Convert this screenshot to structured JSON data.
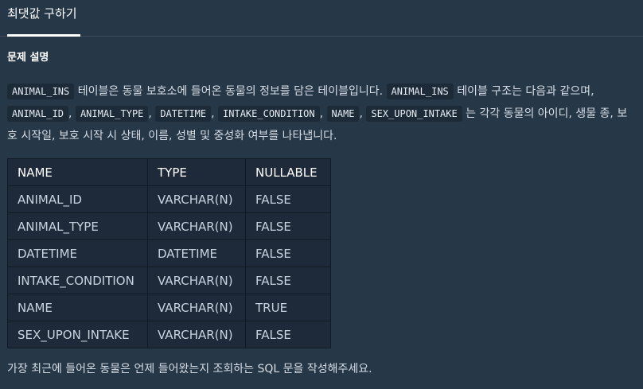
{
  "tab": {
    "label": "최댓값 구하기"
  },
  "problem": {
    "heading": "문제 설명",
    "table_name": "ANIMAL_INS",
    "text1": " 테이블은 동물 보호소에 들어온 동물의 정보를 담은 테이블입니다. ",
    "text2": " 테이블 구조는 다음과 같으며, ",
    "columns": [
      "ANIMAL_ID",
      "ANIMAL_TYPE",
      "DATETIME",
      "INTAKE_CONDITION",
      "NAME",
      "SEX_UPON_INTAKE"
    ],
    "sep": ", ",
    "text3": " 는 각각 동물의 아이디, 생물 종, 보호 시작일, 보호 시작 시 상태, 이름, 성별 및 중성화 여부를 나타냅니다.",
    "question": "가장 최근에 들어온 동물은 언제 들어왔는지 조회하는 SQL 문을 작성해주세요."
  },
  "schema": {
    "headers": [
      "NAME",
      "TYPE",
      "NULLABLE"
    ],
    "rows": [
      [
        "ANIMAL_ID",
        "VARCHAR(N)",
        "FALSE"
      ],
      [
        "ANIMAL_TYPE",
        "VARCHAR(N)",
        "FALSE"
      ],
      [
        "DATETIME",
        "DATETIME",
        "FALSE"
      ],
      [
        "INTAKE_CONDITION",
        "VARCHAR(N)",
        "FALSE"
      ],
      [
        "NAME",
        "VARCHAR(N)",
        "TRUE"
      ],
      [
        "SEX_UPON_INTAKE",
        "VARCHAR(N)",
        "FALSE"
      ]
    ]
  }
}
